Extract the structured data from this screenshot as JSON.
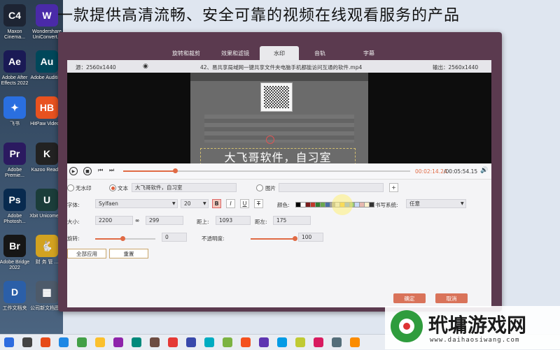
{
  "headline": "一款提供高清流畅、安全可靠的视频在线观看服务的产品",
  "desktop": {
    "icons": [
      {
        "abbr": "C4",
        "label": "Maxon Cinema...",
        "color": "#1d2433"
      },
      {
        "abbr": "W",
        "label": "Wondershare UniConvert...",
        "color": "#4a2aa8"
      },
      {
        "abbr": "Ae",
        "label": "Adobe After Effects 2022",
        "color": "#1a1a55"
      },
      {
        "abbr": "Au",
        "label": "Adobe Audition",
        "color": "#00475a"
      },
      {
        "abbr": "✦",
        "label": "飞书",
        "color": "#2a6fe0"
      },
      {
        "abbr": "HB",
        "label": "HitPaw Video...",
        "color": "#e8521f"
      },
      {
        "abbr": "Pr",
        "label": "Adobe Premie...",
        "color": "#2b1a60"
      },
      {
        "abbr": "K",
        "label": "Kazoo Reader",
        "color": "#222"
      },
      {
        "abbr": "Ps",
        "label": "Adobe Photosh...",
        "color": "#082a4f"
      },
      {
        "abbr": "U",
        "label": "Xbit Unicomet...",
        "color": "#1b3d3a"
      },
      {
        "abbr": "Br",
        "label": "Adobe Bridge 2022",
        "color": "#161616"
      },
      {
        "abbr": "🐇",
        "label": "财 务 管 ...",
        "color": "#d2a220"
      },
      {
        "abbr": "D",
        "label": "工作文档夹",
        "color": "#2b5fa8"
      },
      {
        "abbr": "▦",
        "label": "公司新文档图...",
        "color": "#4d5a6a"
      }
    ]
  },
  "app": {
    "tabs": [
      "旋转和裁剪",
      "效果和滤镜",
      "水印",
      "音轨",
      "字幕"
    ],
    "active_tab": "水印",
    "source_res": "源：2560x1440",
    "filename": "42、易共享局域网一键共享文件夹电脑手机都能访问互通的软件.mp4",
    "output_res": "输出：2560x1440",
    "watermark_text": "大飞哥软件，自习室",
    "time_current": "00:02:14.24",
    "time_total": "/00:05:54.15",
    "progress": 0.18,
    "options": {
      "none": "无水印",
      "text": "文本",
      "text_value": "大飞哥软件，自习室",
      "image": "图片",
      "add": "+"
    },
    "font": {
      "label": "字体:",
      "value": "Sylfaen",
      "size": "20",
      "bold": "B",
      "italic": "I",
      "underline": "U",
      "strike": "T",
      "color_label": "颜色:",
      "writing_label": "书写系统:",
      "writing_value": "任意"
    },
    "swatch_colors": [
      "#000000",
      "#ffffff",
      "#7a1c1c",
      "#c0392b",
      "#2e7d32",
      "#6aa84f",
      "#4a6fa5",
      "#9e9e9e",
      "#e0e0e0",
      "#f1c232",
      "#6d9eeb",
      "#93c47d",
      "#c9daf8",
      "#e6b8af",
      "#fff2cc",
      "#333333"
    ],
    "size": {
      "label": "大小:",
      "w": "2200",
      "h": "299",
      "link": "∞"
    },
    "top": {
      "label": "距上:",
      "value": "1093"
    },
    "left": {
      "label": "距左:",
      "value": "175"
    },
    "rotate": {
      "label": "旋转:",
      "value": "0",
      "level": 0.45
    },
    "opacity": {
      "label": "不透明度:",
      "value": "100",
      "level": 0.95
    },
    "apply_all": "全部应用",
    "reset": "重置",
    "ok": "确定",
    "cancel": "取消"
  },
  "logo": {
    "name": "玳墉游戏网",
    "url": "www.daihaosiwang.com"
  }
}
